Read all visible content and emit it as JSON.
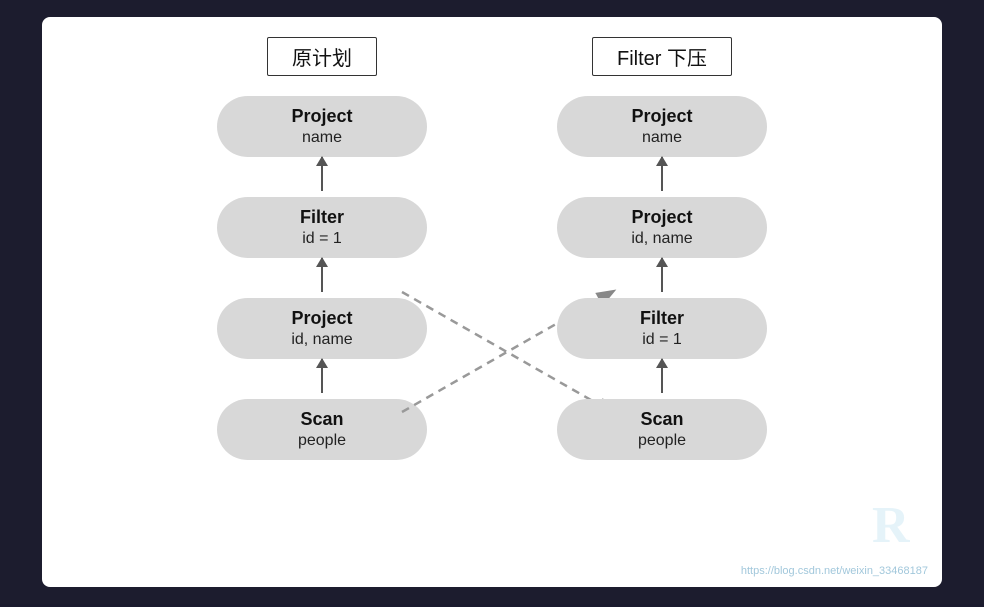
{
  "background": "#1c1c2e",
  "left_column": {
    "title": "原计划",
    "nodes": [
      {
        "title": "Project",
        "subtitle": "name"
      },
      {
        "title": "Filter",
        "subtitle": "id = 1"
      },
      {
        "title": "Project",
        "subtitle": "id, name"
      },
      {
        "title": "Scan",
        "subtitle": "people"
      }
    ]
  },
  "right_column": {
    "title": "Filter 下压",
    "nodes": [
      {
        "title": "Project",
        "subtitle": "name"
      },
      {
        "title": "Project",
        "subtitle": "id, name"
      },
      {
        "title": "Filter",
        "subtitle": "id = 1"
      },
      {
        "title": "Scan",
        "subtitle": "people"
      }
    ]
  },
  "watermark": "https://blog.csdn.net/weixin_33468187"
}
